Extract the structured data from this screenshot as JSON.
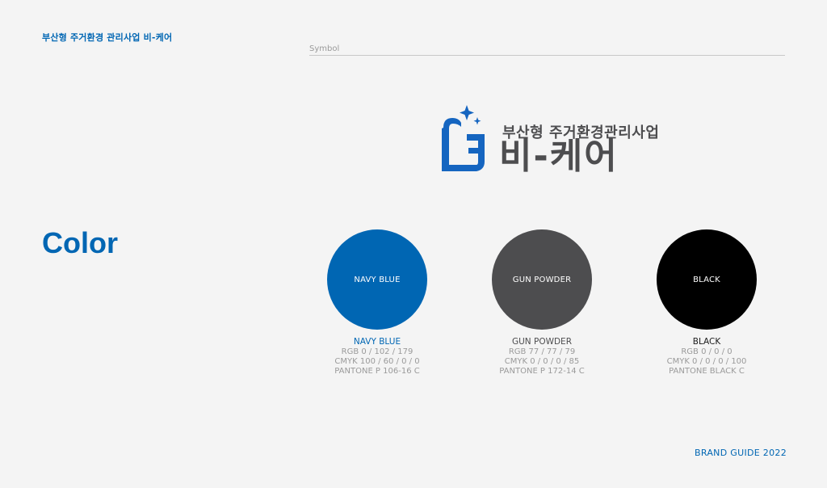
{
  "header": {
    "brand_title": "부산형 주거환경 관리사업 비-케어",
    "section_label": "Symbol"
  },
  "logo": {
    "subtitle": "부산형 주거환경관리사업",
    "main_text": "비-케어",
    "mark_color": "#1565c0",
    "text_color": "#4d4d4f"
  },
  "color_section": {
    "heading": "Color",
    "swatches": [
      {
        "label": "NAVY BLUE",
        "name": "NAVY BLUE",
        "rgb": "RGB 0 / 102 / 179",
        "cmyk": "CMYK 100 / 60 / 0 / 0",
        "pantone": "PANTONE P 106-16 C",
        "hex": "#0066b3",
        "name_color": "#0066b3"
      },
      {
        "label": "GUN POWDER",
        "name": "GUN POWDER",
        "rgb": "RGB 77 / 77 / 79",
        "cmyk": "CMYK 0 / 0 / 0 / 85",
        "pantone": "PANTONE P 172-14 C",
        "hex": "#4d4d4f",
        "name_color": "#4d4d4f"
      },
      {
        "label": "BLACK",
        "name": "BLACK",
        "rgb": "RGB 0 / 0 / 0",
        "cmyk": "CMYK 0 / 0 / 0 / 100",
        "pantone": "PANTONE BLACK C",
        "hex": "#000000",
        "name_color": "#1a1a1a"
      }
    ]
  },
  "footer": {
    "text": "BRAND GUIDE 2022"
  }
}
